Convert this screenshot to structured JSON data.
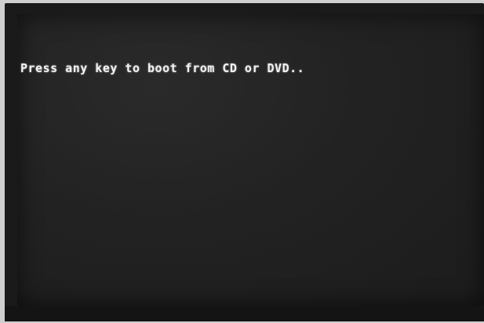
{
  "screen": {
    "message": "Press any key to boot from CD or DVD.."
  },
  "colors": {
    "screen_background": "#222222",
    "text": "#f2f2f2",
    "bezel": "#1a1a1a"
  }
}
